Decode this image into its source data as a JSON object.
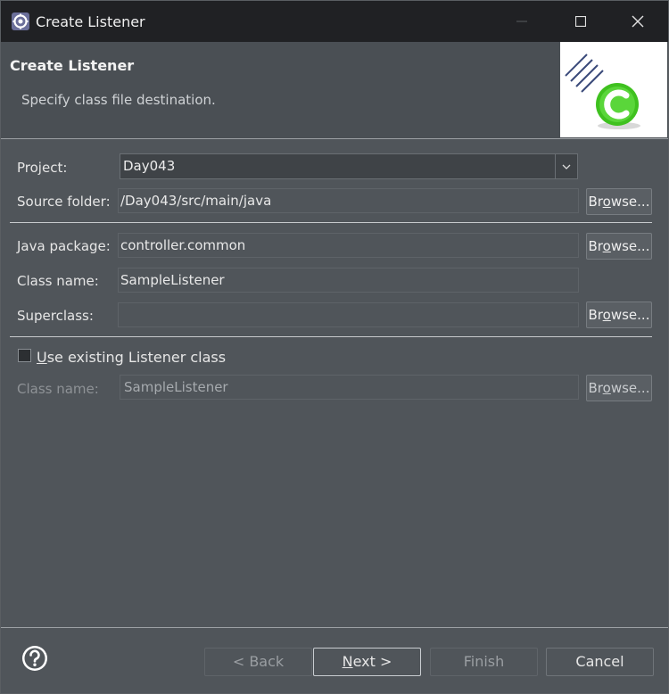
{
  "window": {
    "title": "Create Listener"
  },
  "banner": {
    "title": "Create Listener",
    "description": "Specify class file destination."
  },
  "form": {
    "project_label": "Project:",
    "project_value": "Day043",
    "source_folder_label": "Source folder:",
    "source_folder_value": "/Day043/src/main/java",
    "java_package_label": "Java package:",
    "java_package_value": "controller.common",
    "class_name_label": "Class name:",
    "class_name_value": "SampleListener",
    "superclass_label": "Superclass:",
    "superclass_value": "",
    "use_existing_label": "Use existing Listener class",
    "use_existing_checked": false,
    "existing_class_label": "Class name:",
    "existing_class_value": "SampleListener",
    "browse_label_prefix": "Br",
    "browse_label_mnemonic": "o",
    "browse_label_suffix": "wse..."
  },
  "buttons": {
    "back": "< Back",
    "next_mnemonic": "N",
    "next_rest": "ext >",
    "finish": "Finish",
    "cancel": "Cancel"
  },
  "icons": {
    "app": "eclipse-gear-icon",
    "help": "help-circle-icon",
    "banner": "class-wizard-banner-icon",
    "combo": "chevron-down-icon"
  },
  "colors": {
    "titlebar": "#202124",
    "body": "#50555a",
    "banner_icon_green": "#3fc11f"
  }
}
